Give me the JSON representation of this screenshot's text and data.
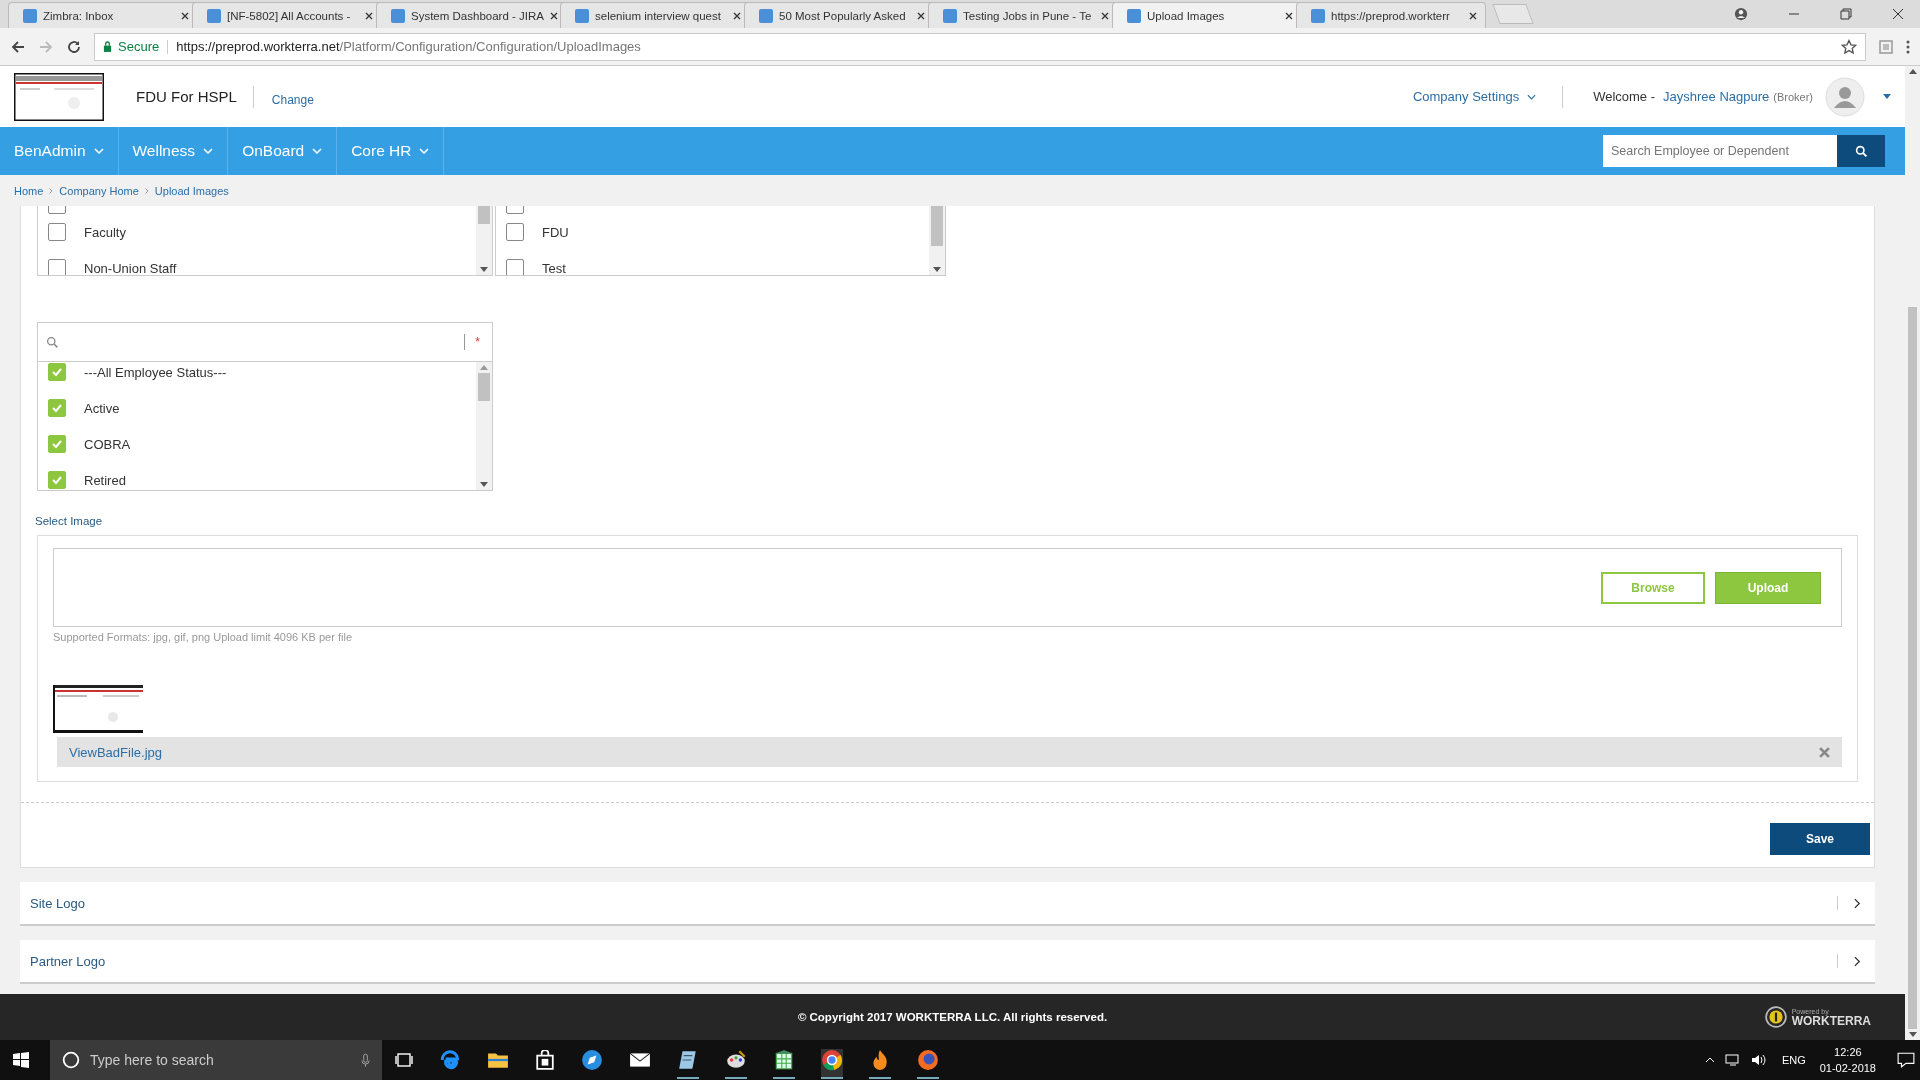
{
  "browser": {
    "tabs": [
      {
        "title": "Zimbra: Inbox",
        "selected": false
      },
      {
        "title": "[NF-5802] All Accounts -",
        "selected": false
      },
      {
        "title": "System Dashboard - JIRA",
        "selected": false
      },
      {
        "title": "selenium interview quest",
        "selected": false
      },
      {
        "title": "50 Most Popularly Asked",
        "selected": false
      },
      {
        "title": "Testing Jobs in Pune - Te",
        "selected": false
      },
      {
        "title": "Upload Images",
        "selected": true
      },
      {
        "title": "https://preprod.workterr",
        "selected": false
      }
    ],
    "secure_label": "Secure",
    "url_host": "https://preprod.workterra.net",
    "url_path": "/Platform/Configuration/Configuration/UploadImages"
  },
  "header": {
    "company": "FDU For HSPL",
    "change_link": "Change",
    "settings_menu": "Company Settings",
    "welcome": "Welcome -",
    "user_name": "Jayshree Nagpure",
    "user_role": "(Broker)"
  },
  "nav": {
    "items": [
      {
        "label": "BenAdmin"
      },
      {
        "label": "Wellness"
      },
      {
        "label": "OnBoard"
      },
      {
        "label": "Core HR"
      }
    ],
    "search": {
      "placeholder": "Search Employee or Dependent"
    }
  },
  "breadcrumb": [
    "Home",
    "Company Home",
    "Upload Images"
  ],
  "lists": [
    {
      "top_item": {
        "checked": false
      },
      "items": [
        {
          "label": "Faculty",
          "checked": false
        },
        {
          "label": "Non-Union Staff",
          "checked": false
        }
      ]
    },
    {
      "top_item": {
        "checked": false
      },
      "items": [
        {
          "label": "FDU",
          "checked": false
        },
        {
          "label": "Test",
          "checked": false
        }
      ]
    }
  ],
  "status_list": {
    "required_mark": "*",
    "items": [
      {
        "label": "---All Employee Status---",
        "checked": true
      },
      {
        "label": "Active",
        "checked": true
      },
      {
        "label": "COBRA",
        "checked": true
      },
      {
        "label": "Retired",
        "checked": true
      }
    ]
  },
  "upload": {
    "label": "Select Image",
    "browse": "Browse",
    "upload": "Upload",
    "hint": "Supported Formats: jpg, gif, png Upload limit 4096 KB per file",
    "file_name": "ViewBadFile.jpg"
  },
  "save": "Save",
  "sections": [
    {
      "title": "Site Logo",
      "expanded": false
    },
    {
      "title": "Partner Logo",
      "expanded": false
    }
  ],
  "footer": {
    "copyright": "© Copyright 2017 WORKTERRA LLC. All rights reserved.",
    "powered_by": "Powered by",
    "brand": "WORKTERRA"
  },
  "taskbar": {
    "search_placeholder": "Type here to search",
    "language": "ENG",
    "time": "12:26",
    "date": "01-02-2018"
  }
}
